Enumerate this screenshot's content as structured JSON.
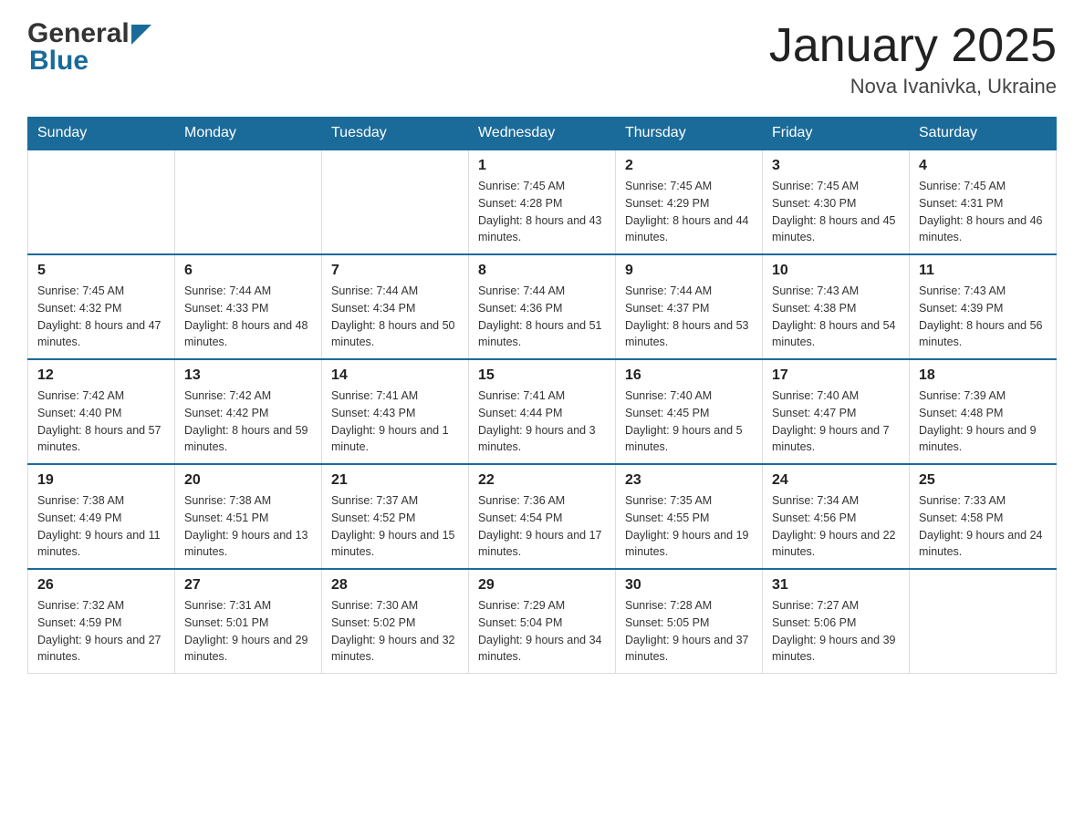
{
  "header": {
    "logo_general": "General",
    "logo_blue": "Blue",
    "month": "January 2025",
    "location": "Nova Ivanivka, Ukraine"
  },
  "days_of_week": [
    "Sunday",
    "Monday",
    "Tuesday",
    "Wednesday",
    "Thursday",
    "Friday",
    "Saturday"
  ],
  "weeks": [
    [
      {
        "day": "",
        "info": ""
      },
      {
        "day": "",
        "info": ""
      },
      {
        "day": "",
        "info": ""
      },
      {
        "day": "1",
        "info": "Sunrise: 7:45 AM\nSunset: 4:28 PM\nDaylight: 8 hours\nand 43 minutes."
      },
      {
        "day": "2",
        "info": "Sunrise: 7:45 AM\nSunset: 4:29 PM\nDaylight: 8 hours\nand 44 minutes."
      },
      {
        "day": "3",
        "info": "Sunrise: 7:45 AM\nSunset: 4:30 PM\nDaylight: 8 hours\nand 45 minutes."
      },
      {
        "day": "4",
        "info": "Sunrise: 7:45 AM\nSunset: 4:31 PM\nDaylight: 8 hours\nand 46 minutes."
      }
    ],
    [
      {
        "day": "5",
        "info": "Sunrise: 7:45 AM\nSunset: 4:32 PM\nDaylight: 8 hours\nand 47 minutes."
      },
      {
        "day": "6",
        "info": "Sunrise: 7:44 AM\nSunset: 4:33 PM\nDaylight: 8 hours\nand 48 minutes."
      },
      {
        "day": "7",
        "info": "Sunrise: 7:44 AM\nSunset: 4:34 PM\nDaylight: 8 hours\nand 50 minutes."
      },
      {
        "day": "8",
        "info": "Sunrise: 7:44 AM\nSunset: 4:36 PM\nDaylight: 8 hours\nand 51 minutes."
      },
      {
        "day": "9",
        "info": "Sunrise: 7:44 AM\nSunset: 4:37 PM\nDaylight: 8 hours\nand 53 minutes."
      },
      {
        "day": "10",
        "info": "Sunrise: 7:43 AM\nSunset: 4:38 PM\nDaylight: 8 hours\nand 54 minutes."
      },
      {
        "day": "11",
        "info": "Sunrise: 7:43 AM\nSunset: 4:39 PM\nDaylight: 8 hours\nand 56 minutes."
      }
    ],
    [
      {
        "day": "12",
        "info": "Sunrise: 7:42 AM\nSunset: 4:40 PM\nDaylight: 8 hours\nand 57 minutes."
      },
      {
        "day": "13",
        "info": "Sunrise: 7:42 AM\nSunset: 4:42 PM\nDaylight: 8 hours\nand 59 minutes."
      },
      {
        "day": "14",
        "info": "Sunrise: 7:41 AM\nSunset: 4:43 PM\nDaylight: 9 hours\nand 1 minute."
      },
      {
        "day": "15",
        "info": "Sunrise: 7:41 AM\nSunset: 4:44 PM\nDaylight: 9 hours\nand 3 minutes."
      },
      {
        "day": "16",
        "info": "Sunrise: 7:40 AM\nSunset: 4:45 PM\nDaylight: 9 hours\nand 5 minutes."
      },
      {
        "day": "17",
        "info": "Sunrise: 7:40 AM\nSunset: 4:47 PM\nDaylight: 9 hours\nand 7 minutes."
      },
      {
        "day": "18",
        "info": "Sunrise: 7:39 AM\nSunset: 4:48 PM\nDaylight: 9 hours\nand 9 minutes."
      }
    ],
    [
      {
        "day": "19",
        "info": "Sunrise: 7:38 AM\nSunset: 4:49 PM\nDaylight: 9 hours\nand 11 minutes."
      },
      {
        "day": "20",
        "info": "Sunrise: 7:38 AM\nSunset: 4:51 PM\nDaylight: 9 hours\nand 13 minutes."
      },
      {
        "day": "21",
        "info": "Sunrise: 7:37 AM\nSunset: 4:52 PM\nDaylight: 9 hours\nand 15 minutes."
      },
      {
        "day": "22",
        "info": "Sunrise: 7:36 AM\nSunset: 4:54 PM\nDaylight: 9 hours\nand 17 minutes."
      },
      {
        "day": "23",
        "info": "Sunrise: 7:35 AM\nSunset: 4:55 PM\nDaylight: 9 hours\nand 19 minutes."
      },
      {
        "day": "24",
        "info": "Sunrise: 7:34 AM\nSunset: 4:56 PM\nDaylight: 9 hours\nand 22 minutes."
      },
      {
        "day": "25",
        "info": "Sunrise: 7:33 AM\nSunset: 4:58 PM\nDaylight: 9 hours\nand 24 minutes."
      }
    ],
    [
      {
        "day": "26",
        "info": "Sunrise: 7:32 AM\nSunset: 4:59 PM\nDaylight: 9 hours\nand 27 minutes."
      },
      {
        "day": "27",
        "info": "Sunrise: 7:31 AM\nSunset: 5:01 PM\nDaylight: 9 hours\nand 29 minutes."
      },
      {
        "day": "28",
        "info": "Sunrise: 7:30 AM\nSunset: 5:02 PM\nDaylight: 9 hours\nand 32 minutes."
      },
      {
        "day": "29",
        "info": "Sunrise: 7:29 AM\nSunset: 5:04 PM\nDaylight: 9 hours\nand 34 minutes."
      },
      {
        "day": "30",
        "info": "Sunrise: 7:28 AM\nSunset: 5:05 PM\nDaylight: 9 hours\nand 37 minutes."
      },
      {
        "day": "31",
        "info": "Sunrise: 7:27 AM\nSunset: 5:06 PM\nDaylight: 9 hours\nand 39 minutes."
      },
      {
        "day": "",
        "info": ""
      }
    ]
  ]
}
